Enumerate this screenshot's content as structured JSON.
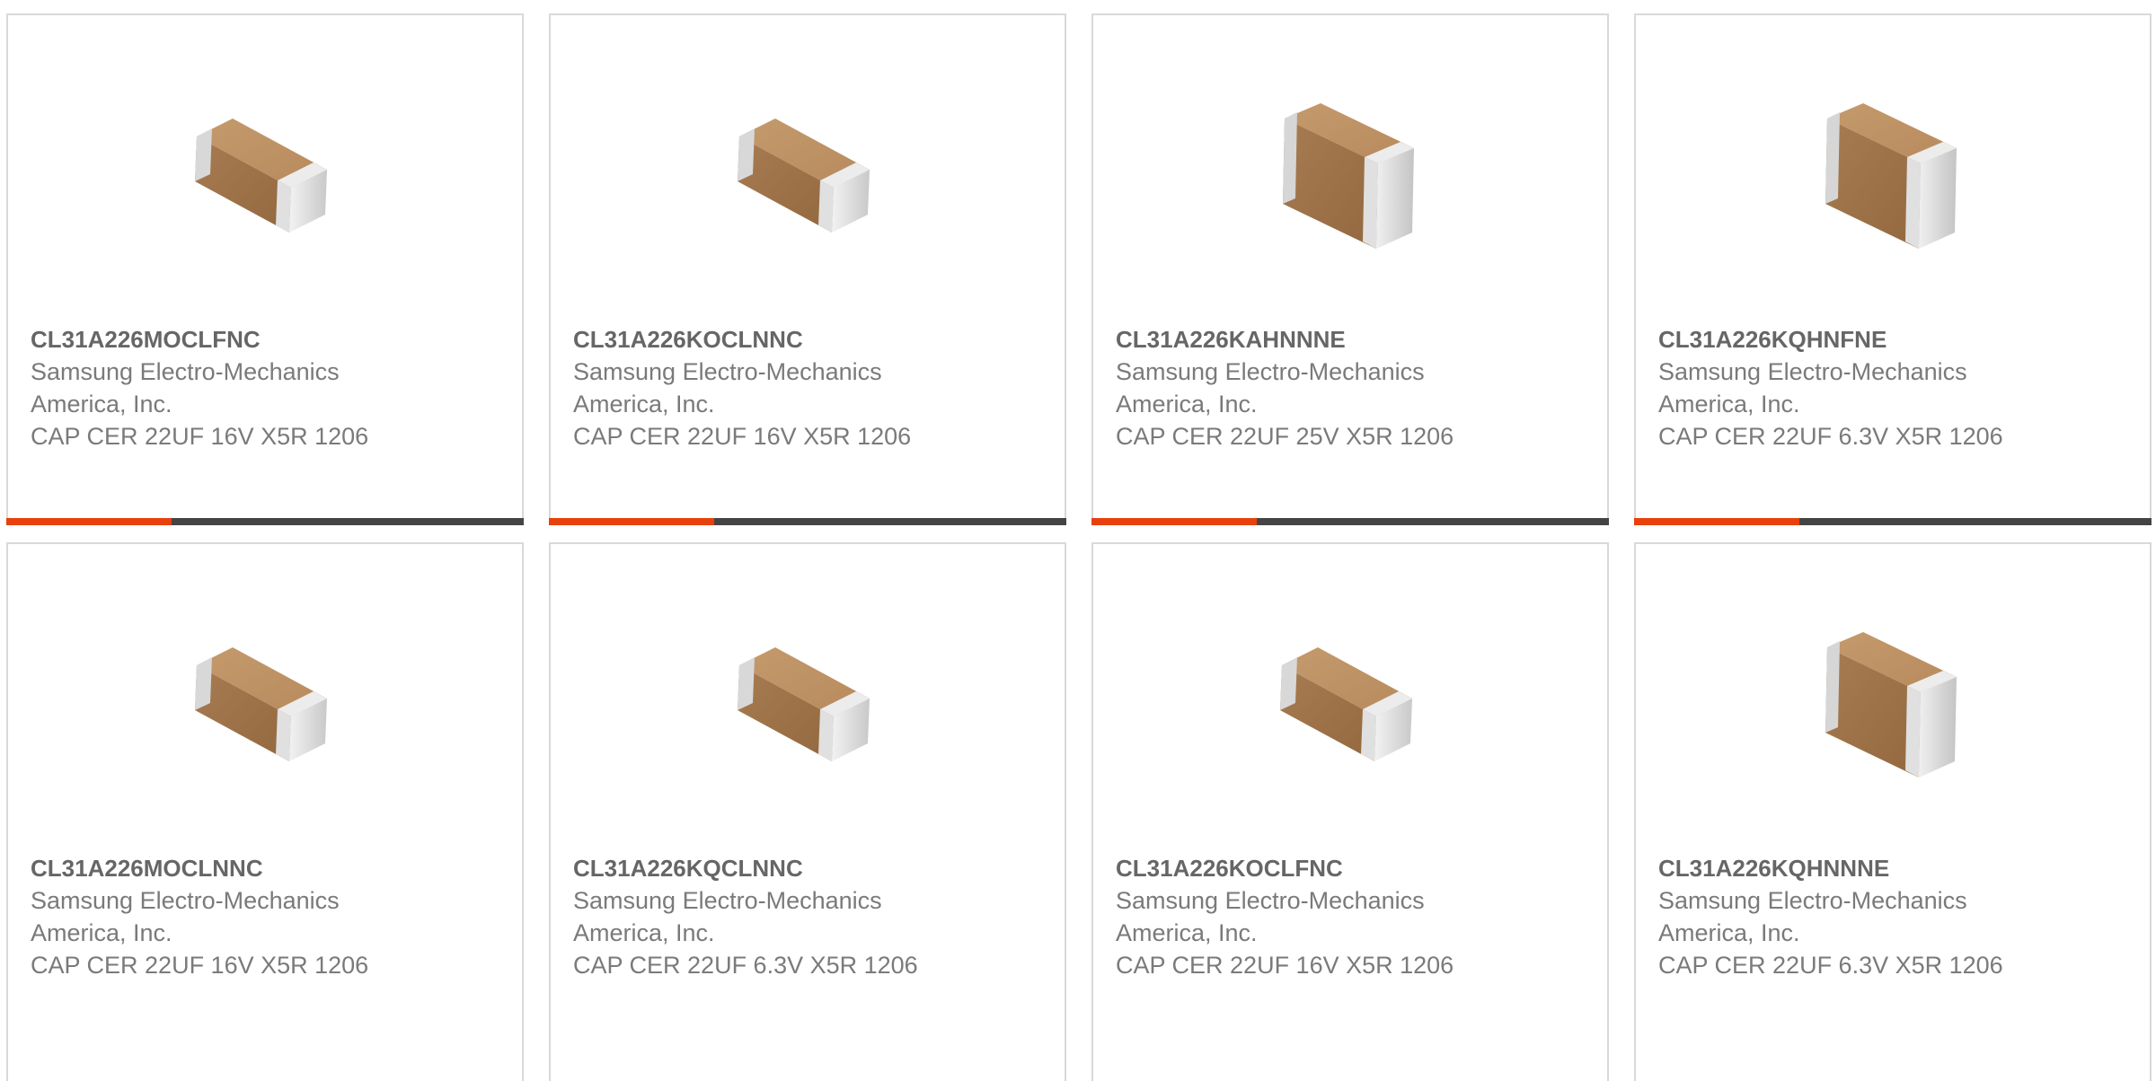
{
  "accent_color": "#e8400c",
  "bar_track_color": "#444444",
  "products": [
    {
      "part": "CL31A226MOCLFNC",
      "manufacturer": "Samsung Electro-Mechanics America, Inc.",
      "description": "CAP CER 22UF 16V X5R 1206",
      "image": "chip-capacitor-flat",
      "progress": 0.32
    },
    {
      "part": "CL31A226KOCLNNC",
      "manufacturer": "Samsung Electro-Mechanics America, Inc.",
      "description": "CAP CER 22UF 16V X5R 1206",
      "image": "chip-capacitor-flat",
      "progress": 0.32
    },
    {
      "part": "CL31A226KAHNNNE",
      "manufacturer": "Samsung Electro-Mechanics America, Inc.",
      "description": "CAP CER 22UF 25V X5R 1206",
      "image": "chip-capacitor-tall",
      "progress": 0.32
    },
    {
      "part": "CL31A226KQHNFNE",
      "manufacturer": "Samsung Electro-Mechanics America, Inc.",
      "description": "CAP CER 22UF 6.3V X5R 1206",
      "image": "chip-capacitor-tall",
      "progress": 0.32
    },
    {
      "part": "CL31A226MOCLNNC",
      "manufacturer": "Samsung Electro-Mechanics America, Inc.",
      "description": "CAP CER 22UF 16V X5R 1206",
      "image": "chip-capacitor-flat"
    },
    {
      "part": "CL31A226KQCLNNC",
      "manufacturer": "Samsung Electro-Mechanics America, Inc.",
      "description": "CAP CER 22UF 6.3V X5R 1206",
      "image": "chip-capacitor-flat"
    },
    {
      "part": "CL31A226KOCLFNC",
      "manufacturer": "Samsung Electro-Mechanics America, Inc.",
      "description": "CAP CER 22UF 16V X5R 1206",
      "image": "chip-capacitor-flat"
    },
    {
      "part": "CL31A226KQHNNNE",
      "manufacturer": "Samsung Electro-Mechanics America, Inc.",
      "description": "CAP CER 22UF 6.3V X5R 1206",
      "image": "chip-capacitor-tall"
    }
  ]
}
